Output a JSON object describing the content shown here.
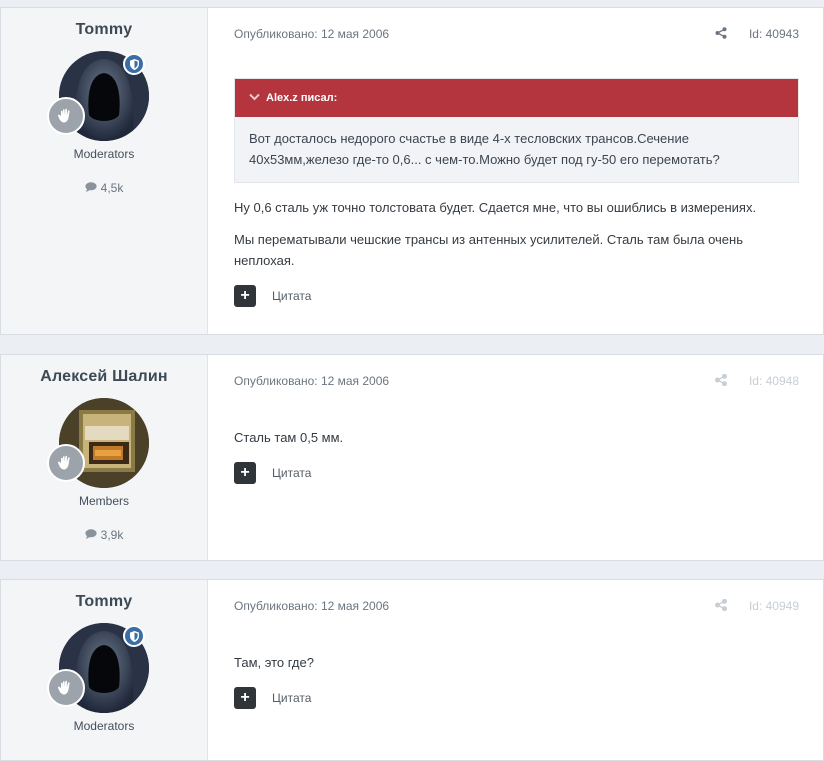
{
  "posts": [
    {
      "author": "Tommy",
      "group": "Moderators",
      "post_count": "4,5k",
      "published": "Опубликовано: 12 мая 2006",
      "id": "Id: 40943",
      "quote": {
        "author": "Alex.z писал:",
        "text": "Вот досталось недорого счастье в виде 4-х тесловских трансов.Сечение 40х53мм,железо где-то 0,6... с чем-то.Можно будет под гу-50 его перемотать?"
      },
      "paragraphs": [
        "Ну 0,6 сталь уж точно толстовата будет. Сдается мне, что вы ошиблись в измерениях.",
        "Мы перематывали чешские трансы из антенных усилителей. Сталь там была очень неплохая."
      ],
      "quote_button": "Цитата"
    },
    {
      "author": "Алексей Шалин",
      "group": "Members",
      "post_count": "3,9k",
      "published": "Опубликовано: 12 мая 2006",
      "id": "Id: 40948",
      "paragraphs": [
        "Сталь там 0,5 мм."
      ],
      "quote_button": "Цитата"
    },
    {
      "author": "Tommy",
      "group": "Moderators",
      "published": "Опубликовано: 12 мая 2006",
      "id": "Id: 40949",
      "paragraphs": [
        "Там, это где?"
      ],
      "quote_button": "Цитата"
    }
  ],
  "colors": {
    "quote_header": "#b5353f",
    "moderator_badge": "#3b6ea6",
    "page_background": "#ebeef2"
  }
}
